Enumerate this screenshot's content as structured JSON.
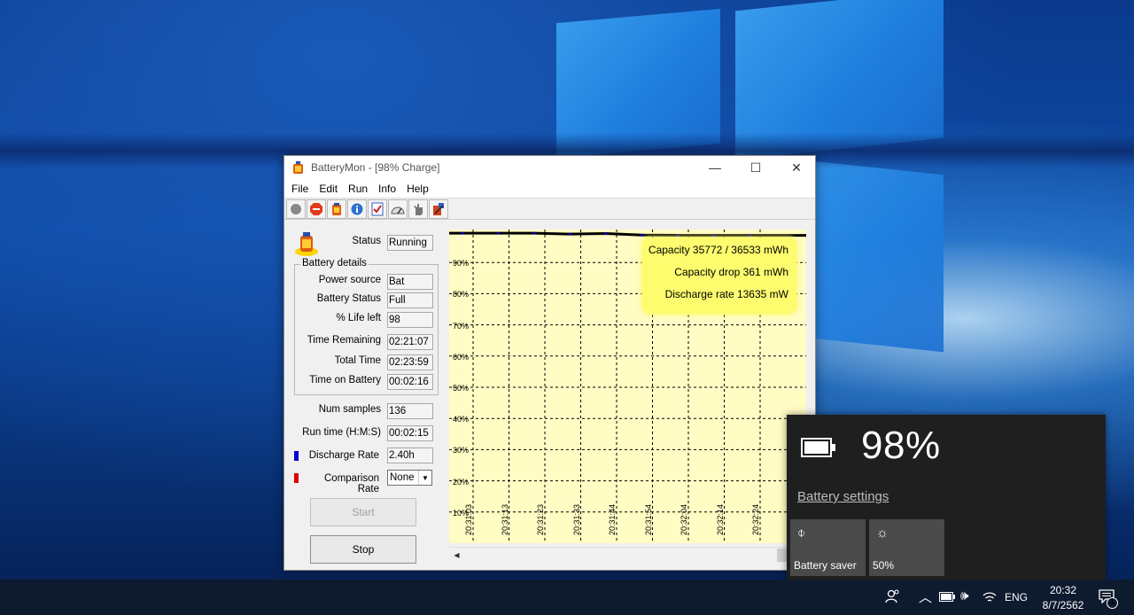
{
  "window": {
    "title": "BatteryMon - [98% Charge]",
    "controls": {
      "minimize": "—",
      "maximize": "☐",
      "close": "✕"
    }
  },
  "menu": [
    "File",
    "Edit",
    "Run",
    "Info",
    "Help"
  ],
  "toolbar_icons": [
    "record-icon",
    "stop-icon",
    "battery-icon",
    "info-icon",
    "checklist-icon",
    "gauge-icon",
    "hand-icon",
    "settings-icon"
  ],
  "status": {
    "label": "Status",
    "value": "Running"
  },
  "battery_details": {
    "title": "Battery details",
    "rows": [
      {
        "label": "Power source",
        "value": "Bat"
      },
      {
        "label": "Battery Status",
        "value": "Full"
      },
      {
        "label": "% Life left",
        "value": "98"
      },
      {
        "label": "Time Remaining",
        "value": "02:21:07"
      },
      {
        "label": "Total Time",
        "value": "02:23:59"
      },
      {
        "label": "Time on Battery",
        "value": "00:02:16"
      }
    ]
  },
  "stats": [
    {
      "label": "Num samples",
      "value": "136"
    },
    {
      "label": "Run time (H:M:S)",
      "value": "00:02:15"
    },
    {
      "label": "Discharge Rate",
      "value": "2.40h"
    }
  ],
  "comparison": {
    "label": "Comparison Rate",
    "selected": "None"
  },
  "colors": {
    "discharge": "#0000cc",
    "comparison": "#dd0000",
    "graph_bg": "#fffcc4",
    "info_box": "#fdfb6e"
  },
  "buttons": {
    "start": "Start",
    "stop": "Stop"
  },
  "graph": {
    "info": [
      "Capacity 35772 / 36533 mWh",
      "Capacity drop 361 mWh",
      "Discharge rate 13635 mW"
    ],
    "y_ticks": [
      "90%",
      "80%",
      "70%",
      "60%",
      "50%",
      "40%",
      "30%",
      "20%",
      "10%"
    ],
    "x_ticks": [
      "20:31:03",
      "20:31:13",
      "20:31:23",
      "20:31:33",
      "20:31:44",
      "20:31:54",
      "20:32:04",
      "20:32:14",
      "20:32:24"
    ]
  },
  "chart_data": {
    "type": "line",
    "x": [
      "20:31:03",
      "20:31:13",
      "20:31:23",
      "20:31:33",
      "20:31:44",
      "20:31:54",
      "20:32:04",
      "20:32:14",
      "20:32:24"
    ],
    "ylim": [
      0,
      100
    ],
    "grid": true,
    "series": [
      {
        "name": "",
        "values": [
          99.4,
          99.4,
          99.4,
          99.1,
          99.3,
          98.8,
          98.7,
          98.7,
          98.7
        ]
      }
    ]
  },
  "flyout": {
    "percent": "98%",
    "settings_link": "Battery settings",
    "tiles": [
      {
        "icon": "battery-saver-icon",
        "label": "Battery saver"
      },
      {
        "icon": "brightness-icon",
        "label": "50%"
      }
    ]
  },
  "taskbar": {
    "language": "ENG",
    "time": "20:32",
    "date": "8/7/2562",
    "notifications": "1"
  }
}
